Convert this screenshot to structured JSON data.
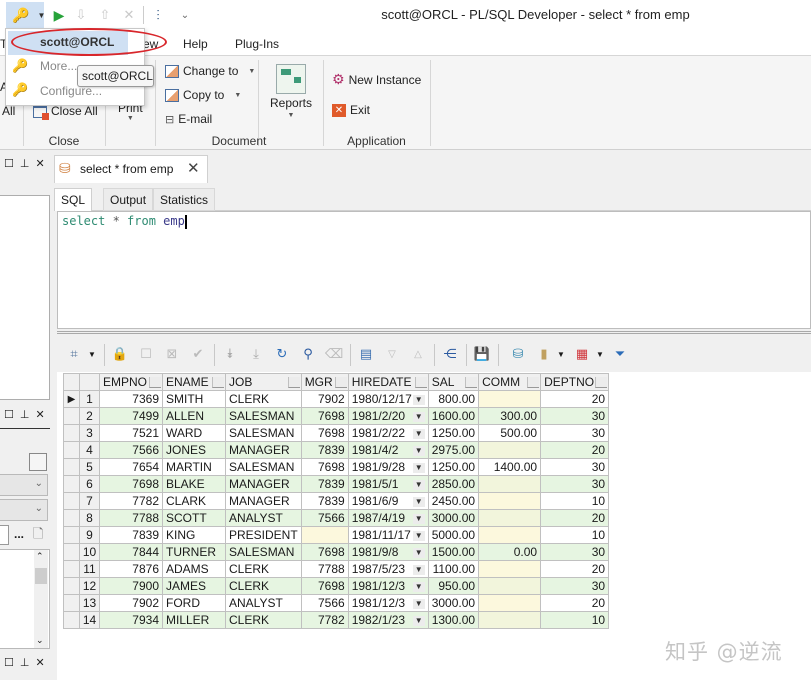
{
  "window": {
    "title": "scott@ORCL - PL/SQL Developer - select * from emp"
  },
  "menubar": {
    "items": [
      {
        "label": "To"
      },
      {
        "label": "ew"
      },
      {
        "label": "Help"
      },
      {
        "label": "Plug-Ins"
      }
    ]
  },
  "connection_dropdown": {
    "items": [
      {
        "label": "scott@ORCL",
        "highlighted": true
      },
      {
        "label": "More..."
      },
      {
        "label": "Configure..."
      }
    ],
    "tooltip": "scott@ORCL",
    "annotation_color": "#d8262b"
  },
  "ribbon": {
    "close_group": {
      "label": "Close",
      "buttons": [
        {
          "label": "All"
        },
        {
          "label": "Close All"
        }
      ]
    },
    "print_button": {
      "label": "Print"
    },
    "document_group": {
      "label": "Document",
      "buttons": [
        {
          "label": "Change to"
        },
        {
          "label": "Copy to"
        },
        {
          "label": "E-mail"
        },
        {
          "label": "Reports"
        }
      ]
    },
    "application_group": {
      "label": "Application",
      "buttons": [
        {
          "label": "New Instance"
        },
        {
          "label": "Exit"
        }
      ]
    },
    "partial_left": {
      "label": "A"
    }
  },
  "document_tab": {
    "label": "select * from emp",
    "close_symbol": "✕"
  },
  "sub_tabs": [
    {
      "label": "SQL",
      "active": true
    },
    {
      "label": "Output",
      "active": false
    },
    {
      "label": "Statistics",
      "active": false
    }
  ],
  "sql_editor": {
    "tokens": [
      {
        "text": "select",
        "type": "keyword"
      },
      {
        "text": " * ",
        "type": "operator"
      },
      {
        "text": "from",
        "type": "keyword"
      },
      {
        "text": " emp",
        "type": "identifier"
      }
    ]
  },
  "grid_toolbar": {
    "icons": [
      "select-cells-icon",
      "dropdown-arrow-icon",
      "lock-icon",
      "new-record-icon",
      "delete-record-icon",
      "post-changes-icon",
      "fetch-next-icon",
      "fetch-last-icon",
      "refresh-icon",
      "find-icon",
      "clear-icon",
      "single-record-view-icon",
      "sort-desc-icon",
      "sort-asc-icon",
      "query-by-example-icon",
      "save-icon",
      "export-icon",
      "chart-icon",
      "table-icon",
      "filter-icon"
    ]
  },
  "grid": {
    "columns": [
      "EMPNO",
      "ENAME",
      "JOB",
      "MGR",
      "HIREDATE",
      "SAL",
      "COMM",
      "DEPTNO"
    ],
    "current_row": 1,
    "rows": [
      {
        "n": "1",
        "empno": "7369",
        "ename": "SMITH",
        "job": "CLERK",
        "mgr": "7902",
        "hiredate": "1980/12/17",
        "sal": "800.00",
        "comm": "",
        "deptno": "20"
      },
      {
        "n": "2",
        "empno": "7499",
        "ename": "ALLEN",
        "job": "SALESMAN",
        "mgr": "7698",
        "hiredate": "1981/2/20",
        "sal": "1600.00",
        "comm": "300.00",
        "deptno": "30"
      },
      {
        "n": "3",
        "empno": "7521",
        "ename": "WARD",
        "job": "SALESMAN",
        "mgr": "7698",
        "hiredate": "1981/2/22",
        "sal": "1250.00",
        "comm": "500.00",
        "deptno": "30"
      },
      {
        "n": "4",
        "empno": "7566",
        "ename": "JONES",
        "job": "MANAGER",
        "mgr": "7839",
        "hiredate": "1981/4/2",
        "sal": "2975.00",
        "comm": "",
        "deptno": "20"
      },
      {
        "n": "5",
        "empno": "7654",
        "ename": "MARTIN",
        "job": "SALESMAN",
        "mgr": "7698",
        "hiredate": "1981/9/28",
        "sal": "1250.00",
        "comm": "1400.00",
        "deptno": "30"
      },
      {
        "n": "6",
        "empno": "7698",
        "ename": "BLAKE",
        "job": "MANAGER",
        "mgr": "7839",
        "hiredate": "1981/5/1",
        "sal": "2850.00",
        "comm": "",
        "deptno": "30"
      },
      {
        "n": "7",
        "empno": "7782",
        "ename": "CLARK",
        "job": "MANAGER",
        "mgr": "7839",
        "hiredate": "1981/6/9",
        "sal": "2450.00",
        "comm": "",
        "deptno": "10"
      },
      {
        "n": "8",
        "empno": "7788",
        "ename": "SCOTT",
        "job": "ANALYST",
        "mgr": "7566",
        "hiredate": "1987/4/19",
        "sal": "3000.00",
        "comm": "",
        "deptno": "20"
      },
      {
        "n": "9",
        "empno": "7839",
        "ename": "KING",
        "job": "PRESIDENT",
        "mgr": "",
        "hiredate": "1981/11/17",
        "sal": "5000.00",
        "comm": "",
        "deptno": "10"
      },
      {
        "n": "10",
        "empno": "7844",
        "ename": "TURNER",
        "job": "SALESMAN",
        "mgr": "7698",
        "hiredate": "1981/9/8",
        "sal": "1500.00",
        "comm": "0.00",
        "deptno": "30"
      },
      {
        "n": "11",
        "empno": "7876",
        "ename": "ADAMS",
        "job": "CLERK",
        "mgr": "7788",
        "hiredate": "1987/5/23",
        "sal": "1100.00",
        "comm": "",
        "deptno": "20"
      },
      {
        "n": "12",
        "empno": "7900",
        "ename": "JAMES",
        "job": "CLERK",
        "mgr": "7698",
        "hiredate": "1981/12/3",
        "sal": "950.00",
        "comm": "",
        "deptno": "30"
      },
      {
        "n": "13",
        "empno": "7902",
        "ename": "FORD",
        "job": "ANALYST",
        "mgr": "7566",
        "hiredate": "1981/12/3",
        "sal": "3000.00",
        "comm": "",
        "deptno": "20"
      },
      {
        "n": "14",
        "empno": "7934",
        "ename": "MILLER",
        "job": "CLERK",
        "mgr": "7782",
        "hiredate": "1982/1/23",
        "sal": "1300.00",
        "comm": "",
        "deptno": "10"
      }
    ]
  },
  "left_panel": {
    "ellipsis": "..."
  },
  "watermark": "知乎 @逆流"
}
